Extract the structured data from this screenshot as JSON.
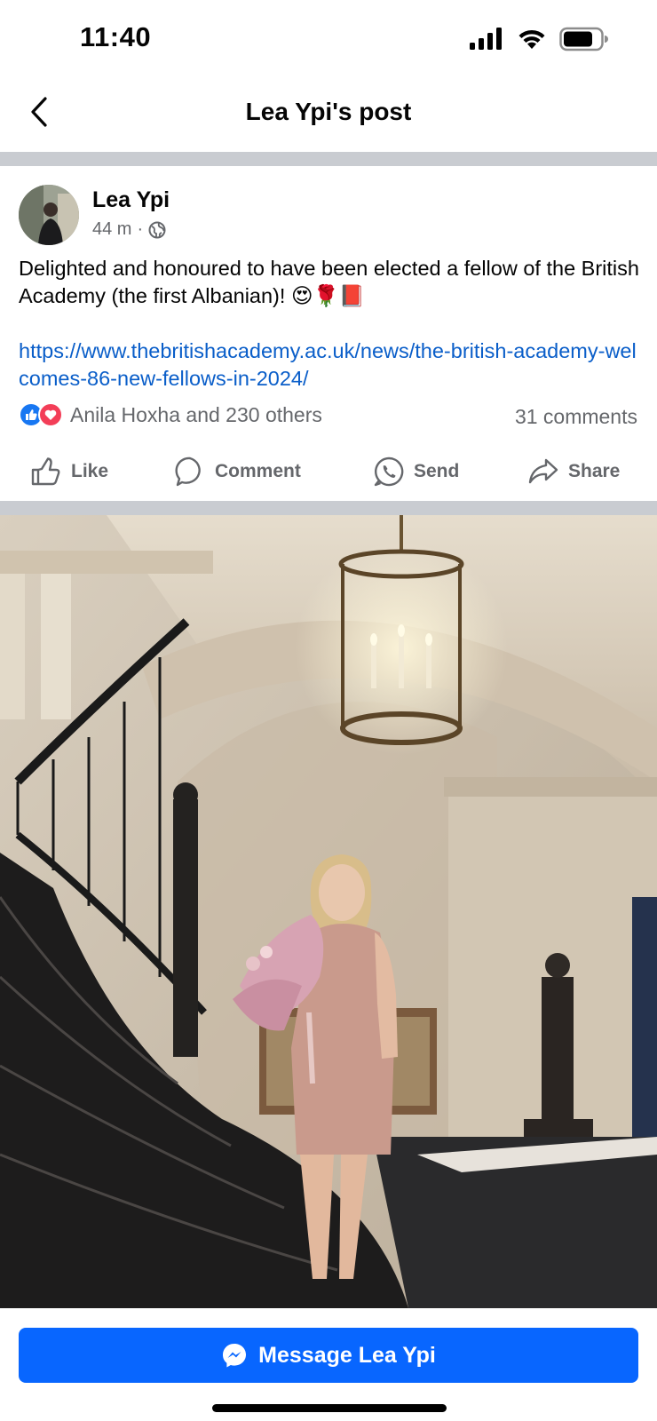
{
  "status_bar": {
    "time": "11:40",
    "battery_fraction": 0.8
  },
  "header": {
    "title": "Lea Ypi's post",
    "back_icon": "chevron-left-icon"
  },
  "post": {
    "author": "Lea Ypi",
    "time_ago": "44 m",
    "separator": "·",
    "privacy_icon": "globe-icon",
    "text": "Delighted and honoured to have been elected a fellow of the British Academy (the first Albanian)! 😍🌹📕",
    "link": "https://www.thebritishacademy.ac.uk/news/the-british-academy-welcomes-86-new-fellows-in-2024/",
    "reactions_text": "Anila Hoxha and 230 others",
    "comments_text": "31 comments"
  },
  "actions": {
    "like": "Like",
    "comment": "Comment",
    "send": "Send",
    "share": "Share"
  },
  "bottom": {
    "message_label": "Message Lea Ypi"
  },
  "colors": {
    "accent": "#0866ff",
    "link": "#0a5ec9",
    "like": "#1877f2",
    "love": "#f33e58",
    "muted": "#65676b"
  }
}
